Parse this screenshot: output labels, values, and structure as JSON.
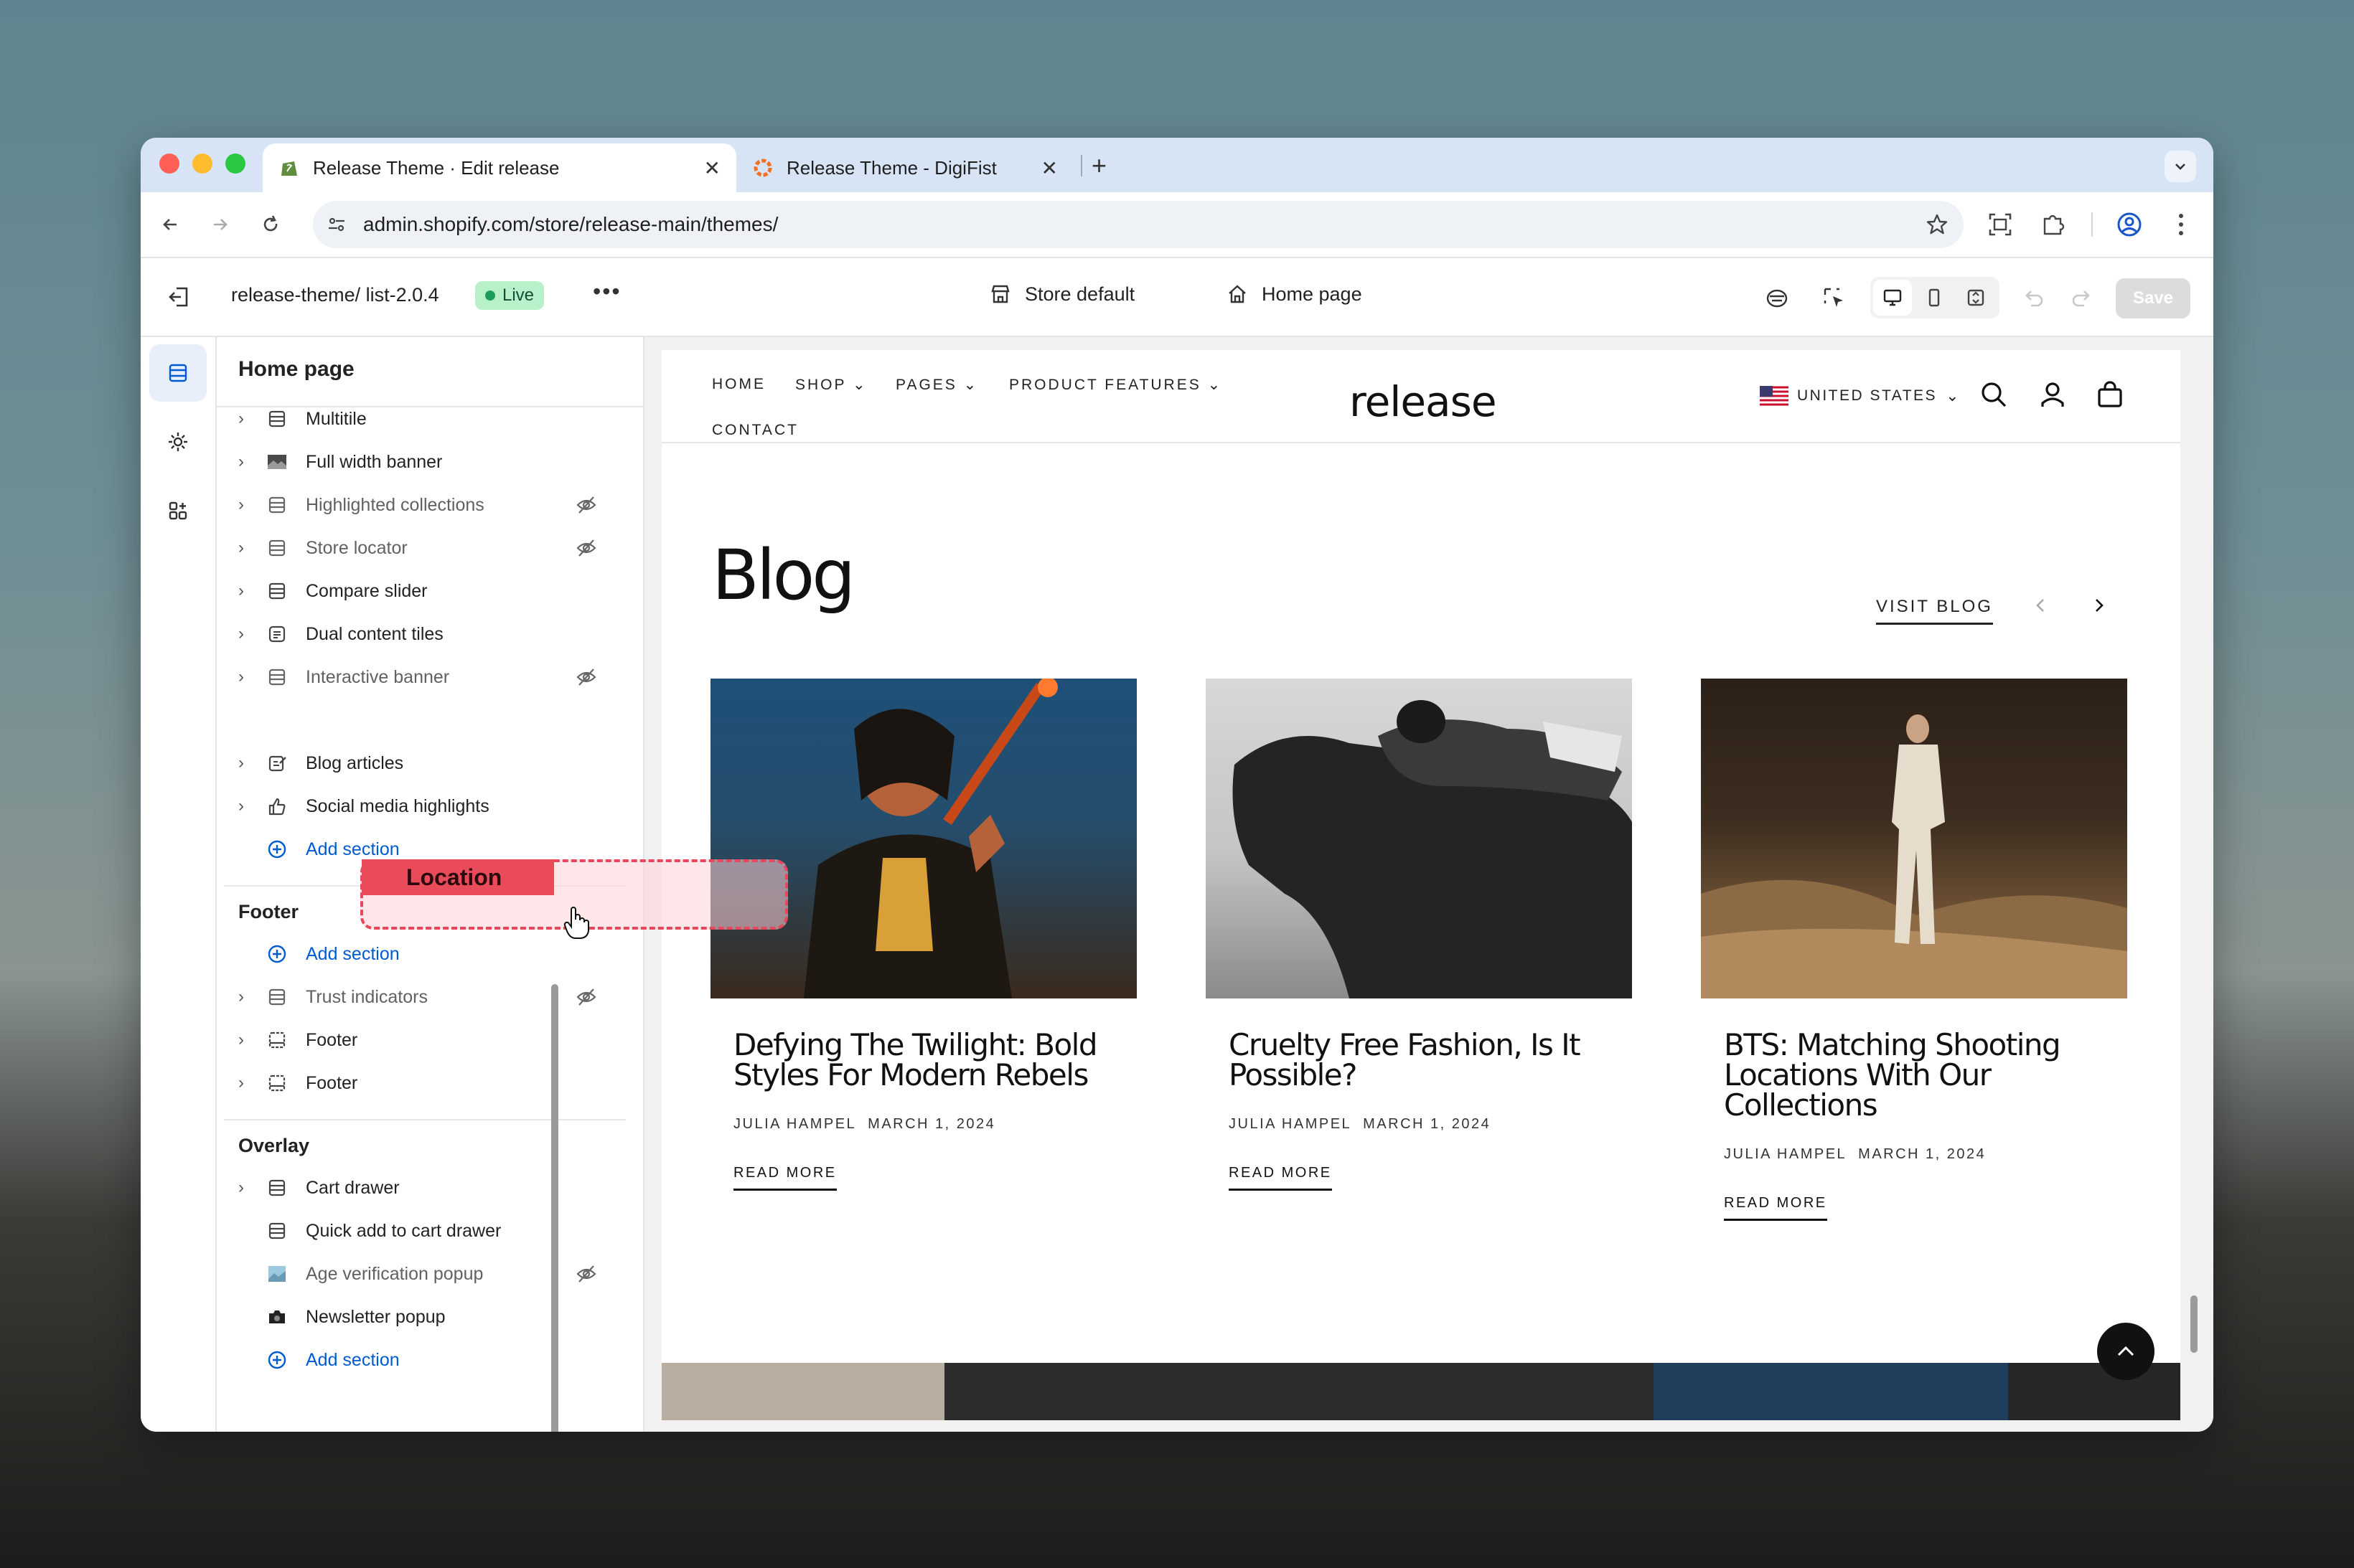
{
  "browser": {
    "tabs": [
      {
        "title": "Release Theme · Edit release",
        "active": true
      },
      {
        "title": "Release Theme - DigiFist",
        "active": false
      }
    ],
    "url": "admin.shopify.com/store/release-main/themes/"
  },
  "editor": {
    "theme_name": "release-theme/ list-2.0.4",
    "live_badge": "Live",
    "store_selector": "Store default",
    "page_selector": "Home page",
    "save_label": "Save"
  },
  "sidebar": {
    "title": "Home page",
    "template_sections": [
      {
        "label": "Multitile",
        "icon": "section-icon",
        "hidden": false
      },
      {
        "label": "Full width banner",
        "icon": "image-icon",
        "hidden": false
      },
      {
        "label": "Highlighted collections",
        "icon": "section-icon",
        "hidden": true
      },
      {
        "label": "Store locator",
        "icon": "section-icon",
        "hidden": true
      },
      {
        "label": "Compare slider",
        "icon": "section-icon",
        "hidden": false
      },
      {
        "label": "Dual content tiles",
        "icon": "text-icon",
        "hidden": false
      },
      {
        "label": "Interactive banner",
        "icon": "section-icon",
        "hidden": true
      },
      {
        "label": "Blog articles",
        "icon": "blog-icon",
        "hidden": false
      },
      {
        "label": "Social media highlights",
        "icon": "thumbs-up-icon",
        "hidden": false
      }
    ],
    "add_section": "Add section",
    "footer_title": "Footer",
    "footer_sections": [
      {
        "label": "Trust indicators",
        "hidden": true
      },
      {
        "label": "Footer",
        "hidden": false
      },
      {
        "label": "Footer",
        "hidden": false
      }
    ],
    "overlay_title": "Overlay",
    "overlay_sections": [
      {
        "label": "Cart drawer",
        "hidden": false,
        "chevron": true
      },
      {
        "label": "Quick add to cart drawer",
        "hidden": false,
        "chevron": false
      },
      {
        "label": "Age verification popup",
        "hidden": true,
        "chevron": false
      },
      {
        "label": "Newsletter popup",
        "hidden": false,
        "chevron": false
      }
    ],
    "drag_label": "Location"
  },
  "preview": {
    "nav": [
      "HOME",
      "SHOP",
      "PAGES",
      "PRODUCT FEATURES",
      "CONTACT"
    ],
    "logo": "release",
    "country": "UNITED STATES",
    "blog_heading": "Blog",
    "visit_blog": "VISIT BLOG",
    "articles": [
      {
        "title": "Defying The Twilight: Bold Styles For Modern Rebels",
        "author": "JULIA HAMPEL",
        "date": "MARCH 1, 2024",
        "read_more": "READ MORE"
      },
      {
        "title": "Cruelty Free Fashion, Is It Possible?",
        "author": "JULIA HAMPEL",
        "date": "MARCH 1, 2024",
        "read_more": "READ MORE"
      },
      {
        "title": "BTS: Matching Shooting Locations With Our Collections",
        "author": "JULIA HAMPEL",
        "date": "MARCH 1, 2024",
        "read_more": "READ MORE"
      }
    ]
  },
  "colors": {
    "accent_blue": "#005bd3",
    "live_green": "#1a9e5a",
    "drop_red": "#ea4b5b"
  }
}
